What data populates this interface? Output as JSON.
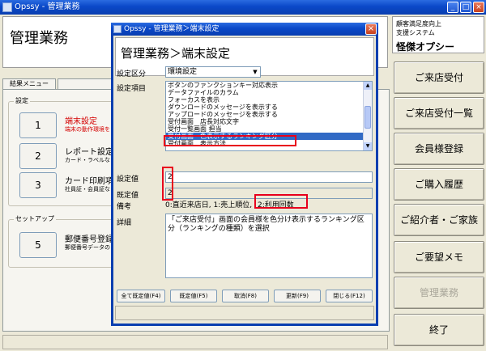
{
  "main_window": {
    "title": "Opssy - 管理業務"
  },
  "header": {
    "title": "管理業務"
  },
  "brand": {
    "line1": "顧客満足度向上",
    "line2": "支援システム",
    "name": "怪傑オプシー"
  },
  "tabs": [
    {
      "label": "結果メニュー"
    },
    {
      "label": ""
    }
  ],
  "groups": {
    "settings": "設定",
    "setup": "セットアップ"
  },
  "menu": [
    {
      "number": "1",
      "label": "端末設定",
      "desc": "端末の動作環境を"
    },
    {
      "number": "2",
      "label": "レポート設定",
      "desc": "カード・ラベルなど"
    },
    {
      "number": "3",
      "label": "カード印刷項目",
      "desc": "社員証・会員証な"
    },
    {
      "number": "5",
      "label": "郵便番号登録",
      "desc": "郵便番号データの"
    }
  ],
  "sidebar": [
    {
      "label": "ご来店受付",
      "enabled": true
    },
    {
      "label": "ご来店受付一覧",
      "enabled": true
    },
    {
      "label": "会員様登録",
      "enabled": true
    },
    {
      "label": "ご購入履歴",
      "enabled": true
    },
    {
      "label": "ご紹介者・ご家族",
      "enabled": true
    },
    {
      "label": "ご要望メモ",
      "enabled": true
    },
    {
      "label": "管理業務",
      "enabled": false
    },
    {
      "label": "終了",
      "enabled": true
    }
  ],
  "dialog": {
    "titlebar": "Opssy - 管理業務＞端末設定",
    "title": "管理業務＞端末設定",
    "labels": {
      "category": "設定区分",
      "items": "設定項目",
      "value": "設定値",
      "default": "既定値",
      "remark": "備考",
      "detail": "詳細"
    },
    "category_value": "環境設定",
    "list_items": [
      "ボタンのファンクションキー対応表示",
      "データファイルのカラム",
      "フォーカスを表示",
      "ダウンロードのメッセージを表示する",
      "アップロードのメッセージを表示する",
      "受付画面　店長対応文字",
      "受付一覧画面 担当",
      "受付画面　色表示するランキング区分",
      "受付画面　表示方法"
    ],
    "selected_index": 7,
    "value": "2",
    "default_value": "2",
    "remark_text": "0:直近来店日, 1:売上順位,",
    "remark_highlight": "2:利用回数",
    "detail_text": "「ご来店受付」画面の会員様を色分け表示するランキング区分（ランキングの種類）を選択",
    "buttons": {
      "all_default": "全て既定値(F4)",
      "default": "既定値(F5)",
      "cancel": "取消(F8)",
      "update": "更新(F9)",
      "close": "閉じる(F12)"
    }
  },
  "colors": {
    "titlebar": "#0a48c8",
    "highlight": "#e8001c",
    "selection": "#316ac5",
    "menu_red": "#d40000"
  }
}
